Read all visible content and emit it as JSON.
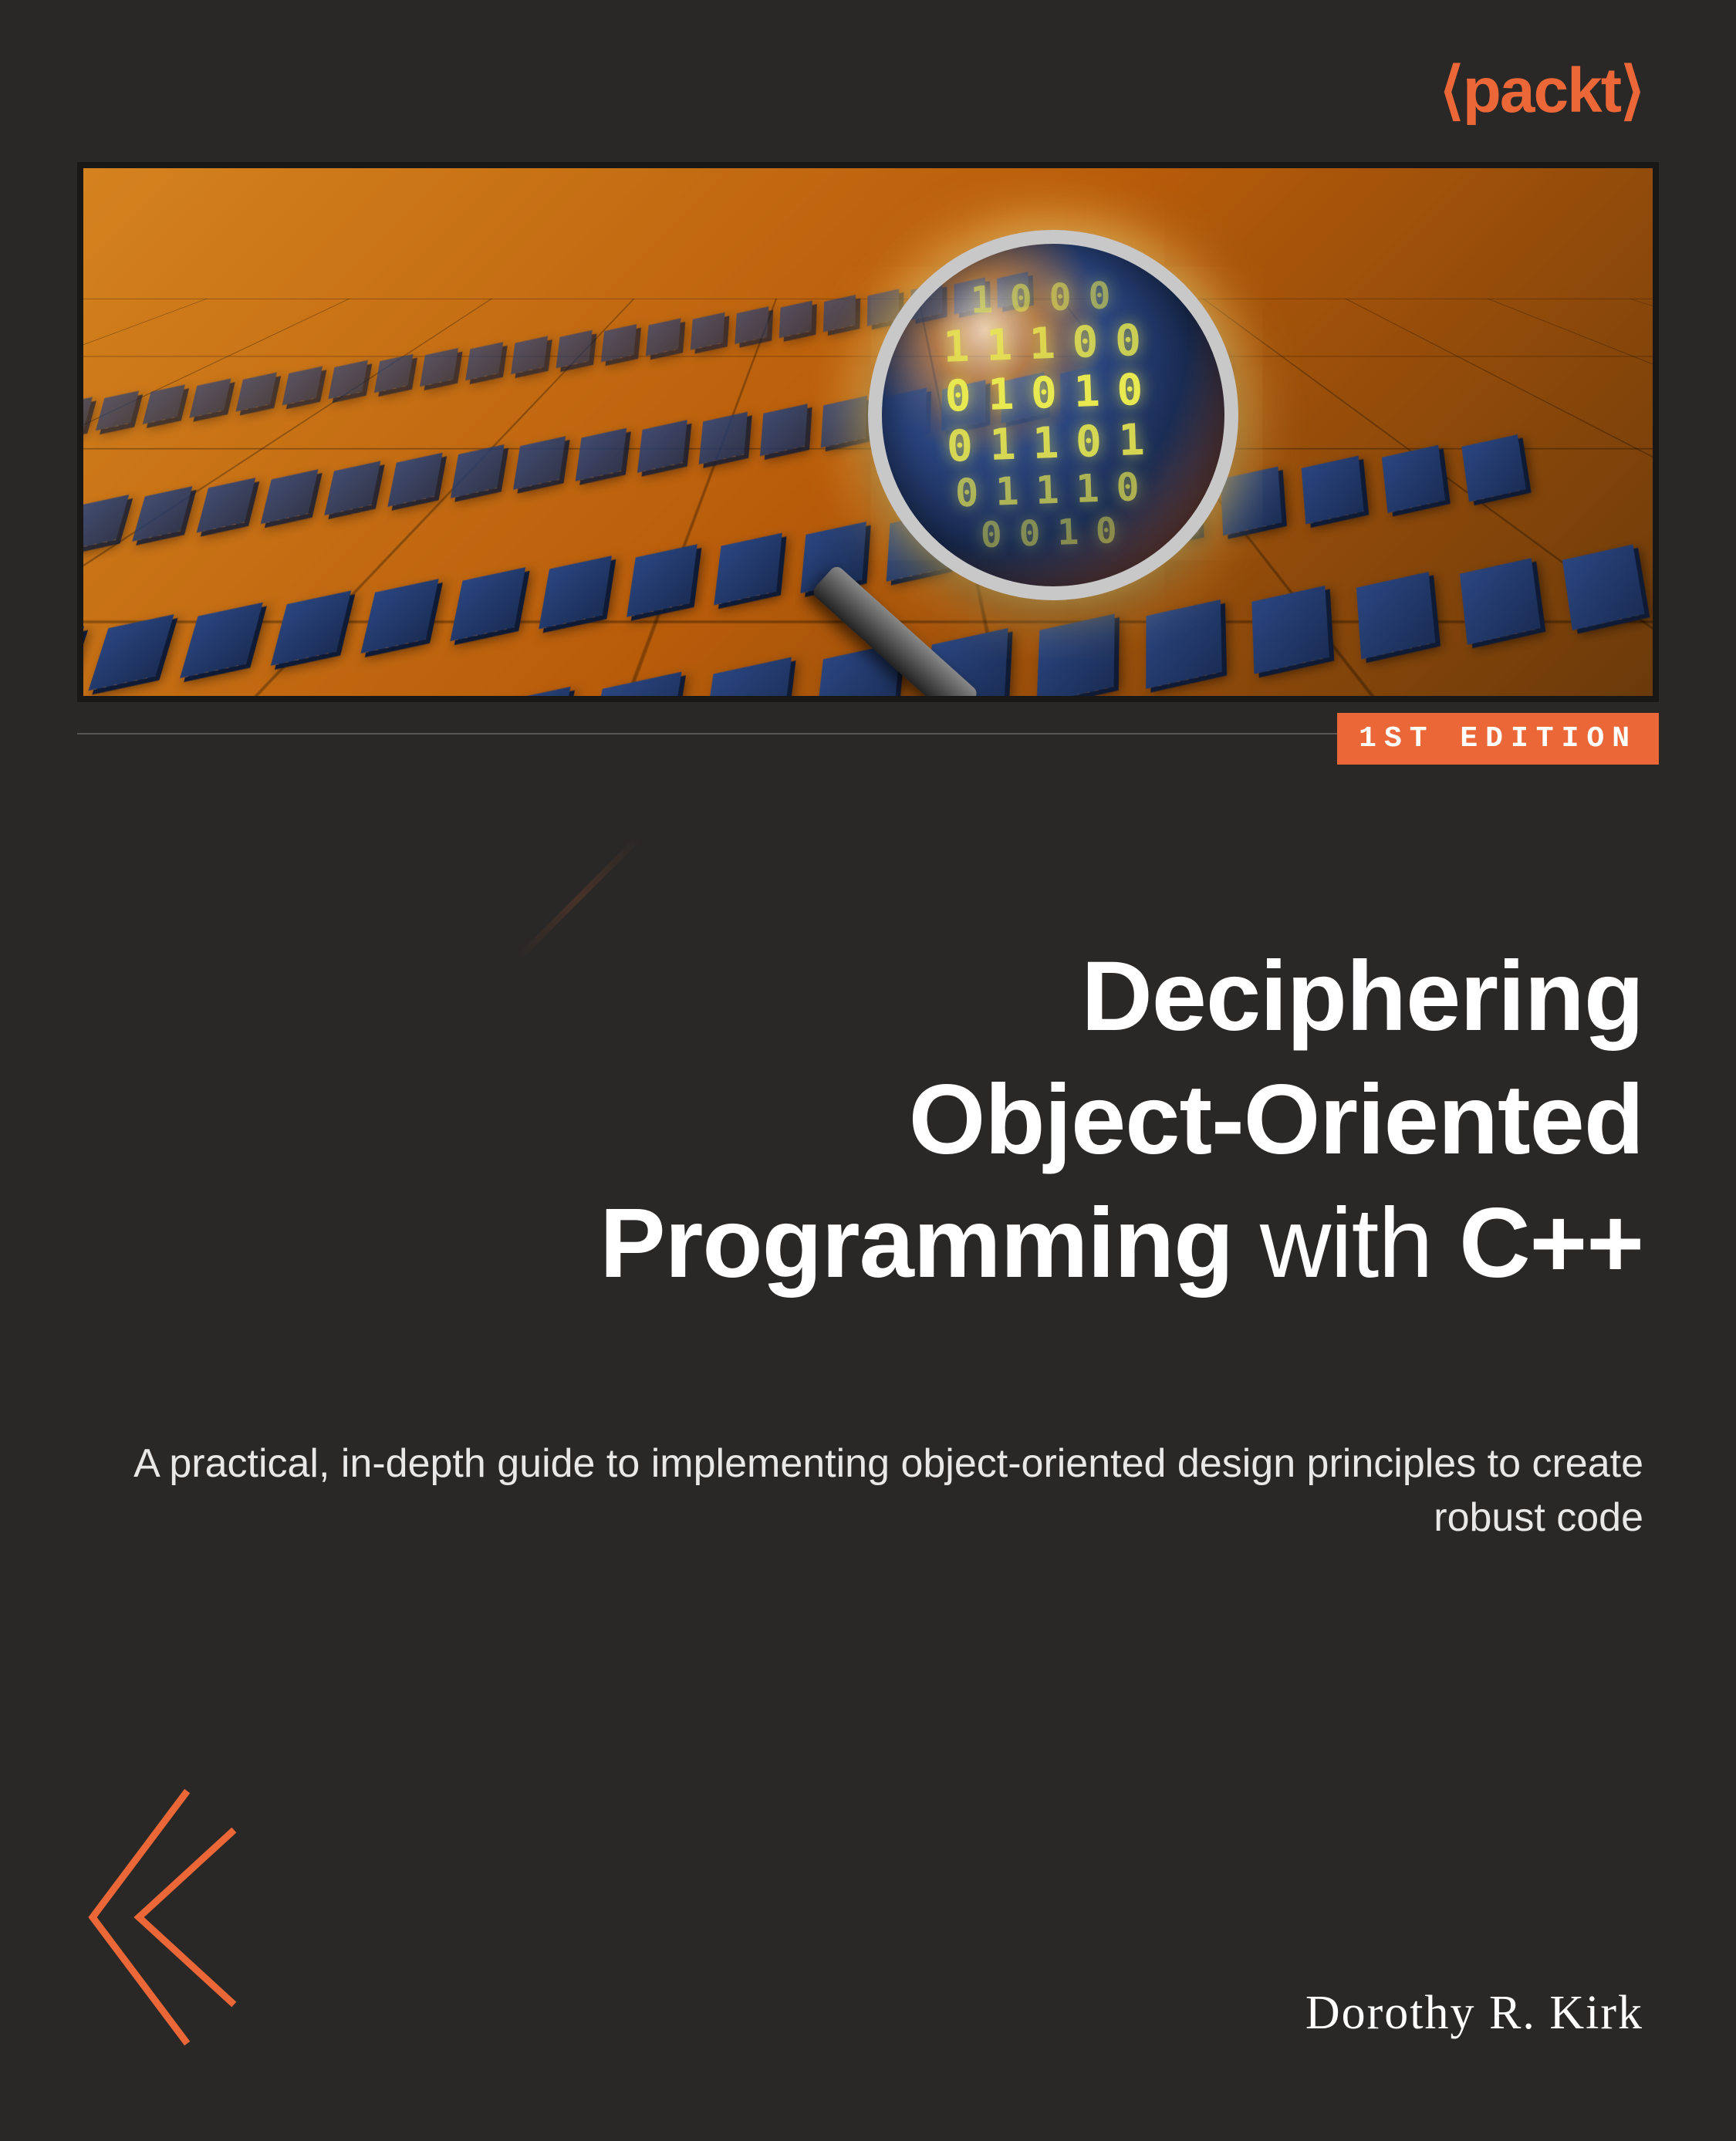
{
  "publisher": "⟨packt⟩",
  "edition": "1ST EDITION",
  "title_line1": "Deciphering",
  "title_line2": "Object-Oriented",
  "title_line3_bold": "Programming",
  "title_line3_light": " with ",
  "title_line3_bold2": "C++",
  "subtitle": "A practical, in-depth guide to implementing object-oriented design principles to create robust code",
  "author": "Dorothy R. Kirk",
  "binary_lines": [
    "1000",
    "11100",
    "01010",
    "01101",
    "01110",
    "0010"
  ],
  "colors": {
    "accent": "#ec6737",
    "background": "#2a2826",
    "text": "#ffffff"
  }
}
